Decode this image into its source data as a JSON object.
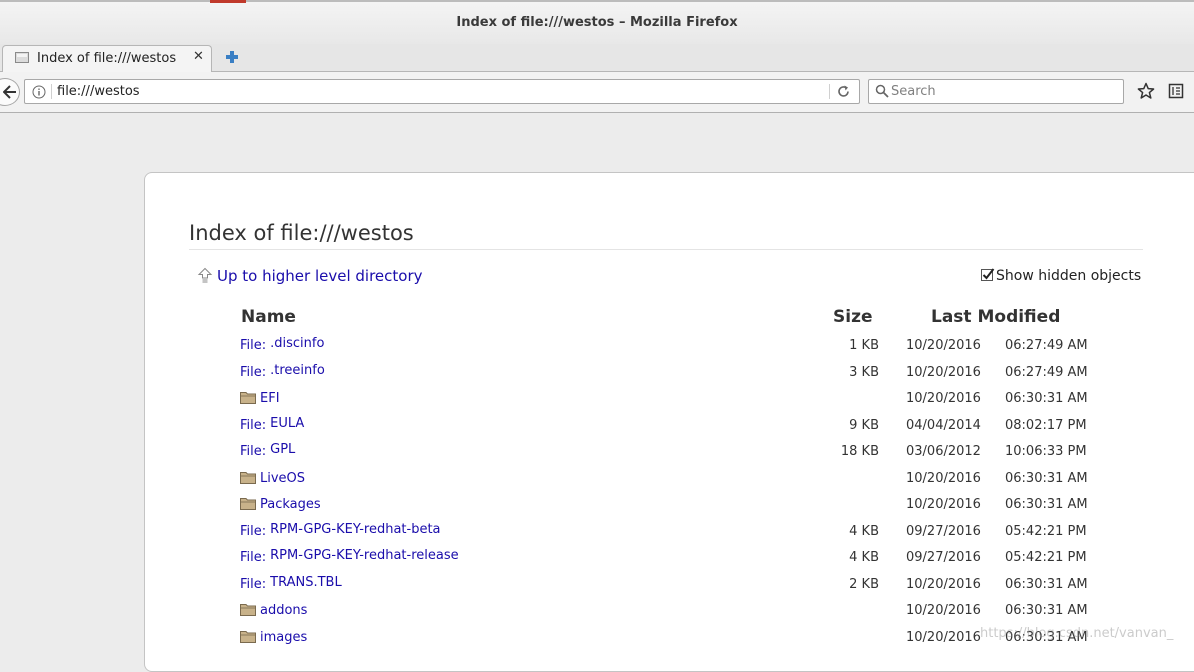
{
  "window": {
    "title": "Index of file:///westos – Mozilla Firefox"
  },
  "tab": {
    "title": "Index of file:///westos",
    "close": "✕",
    "new_tab": "+"
  },
  "navbar": {
    "url": "file:///westos",
    "search_placeholder": "Search"
  },
  "page": {
    "heading": "Index of file:///westos",
    "up_link": "Up to higher level directory",
    "show_hidden_label": "Show hidden objects",
    "show_hidden_checked": true,
    "columns": {
      "name": "Name",
      "size": "Size",
      "modified": "Last Modified"
    },
    "file_prefix": "File:",
    "rows": [
      {
        "type": "file",
        "name": ".discinfo",
        "size": "1 KB",
        "date": "10/20/2016",
        "time": "06:27:49 AM"
      },
      {
        "type": "file",
        "name": ".treeinfo",
        "size": "3 KB",
        "date": "10/20/2016",
        "time": "06:27:49 AM"
      },
      {
        "type": "folder",
        "name": "EFI",
        "size": "",
        "date": "10/20/2016",
        "time": "06:30:31 AM"
      },
      {
        "type": "file",
        "name": "EULA",
        "size": "9 KB",
        "date": "04/04/2014",
        "time": "08:02:17 PM"
      },
      {
        "type": "file",
        "name": "GPL",
        "size": "18 KB",
        "date": "03/06/2012",
        "time": "10:06:33 PM"
      },
      {
        "type": "folder",
        "name": "LiveOS",
        "size": "",
        "date": "10/20/2016",
        "time": "06:30:31 AM"
      },
      {
        "type": "folder",
        "name": "Packages",
        "size": "",
        "date": "10/20/2016",
        "time": "06:30:31 AM"
      },
      {
        "type": "file",
        "name": "RPM-GPG-KEY-redhat-beta",
        "size": "4 KB",
        "date": "09/27/2016",
        "time": "05:42:21 PM"
      },
      {
        "type": "file",
        "name": "RPM-GPG-KEY-redhat-release",
        "size": "4 KB",
        "date": "09/27/2016",
        "time": "05:42:21 PM"
      },
      {
        "type": "file",
        "name": "TRANS.TBL",
        "size": "2 KB",
        "date": "10/20/2016",
        "time": "06:30:31 AM"
      },
      {
        "type": "folder",
        "name": "addons",
        "size": "",
        "date": "10/20/2016",
        "time": "06:30:31 AM"
      },
      {
        "type": "folder",
        "name": "images",
        "size": "",
        "date": "10/20/2016",
        "time": "06:30:31 AM"
      }
    ]
  },
  "watermark": "https://blog.csdn.net/vanvan_",
  "icons": {
    "tab": "page-icon",
    "new_tab": "plus-icon",
    "back": "back-arrow-icon",
    "info": "info-icon",
    "reload": "reload-icon",
    "search": "search-icon",
    "bookmark": "star-icon",
    "library": "library-icon",
    "up": "up-arrow-icon",
    "folder": "folder-icon",
    "checkbox": "checkmark-icon"
  },
  "colors": {
    "link": "#1a0dab",
    "folder": "#c8b28a",
    "new_tab": "#3a7fc4"
  }
}
